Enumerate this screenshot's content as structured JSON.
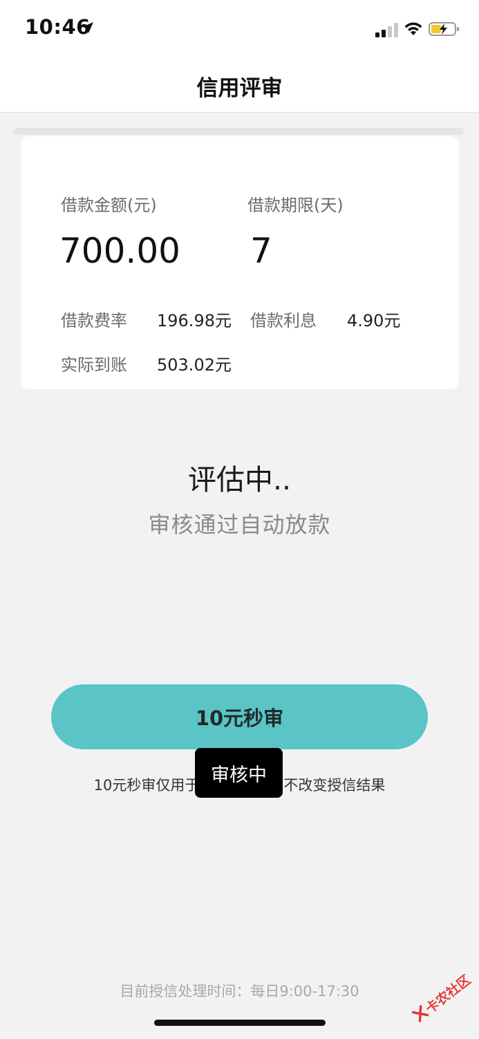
{
  "status_bar": {
    "time": "10:46"
  },
  "header": {
    "title": "信用评审"
  },
  "loan": {
    "amount_label": "借款金额(元)",
    "amount_value": "700.00",
    "term_label": "借款期限(天)",
    "term_value": "7",
    "fee_label": "借款费率",
    "fee_value": "196.98元",
    "interest_label": "借款利息",
    "interest_value": "4.90元",
    "actual_label": "实际到账",
    "actual_value": "503.02元"
  },
  "status": {
    "title": "评估中..",
    "subtitle": "审核通过自动放款"
  },
  "action": {
    "button_label": "10元秒审",
    "note_left": "10元秒审仅用于",
    "note_right": "不改变授信结果"
  },
  "toast": {
    "text": "审核中"
  },
  "footer": {
    "text": "目前授信处理时间：每日9:00-17:30"
  },
  "watermark": {
    "text": "卡农社区"
  },
  "colors": {
    "accent": "#5bc4c7",
    "background": "#f2f2f2",
    "card": "#ffffff",
    "watermark": "#e03a3a"
  }
}
